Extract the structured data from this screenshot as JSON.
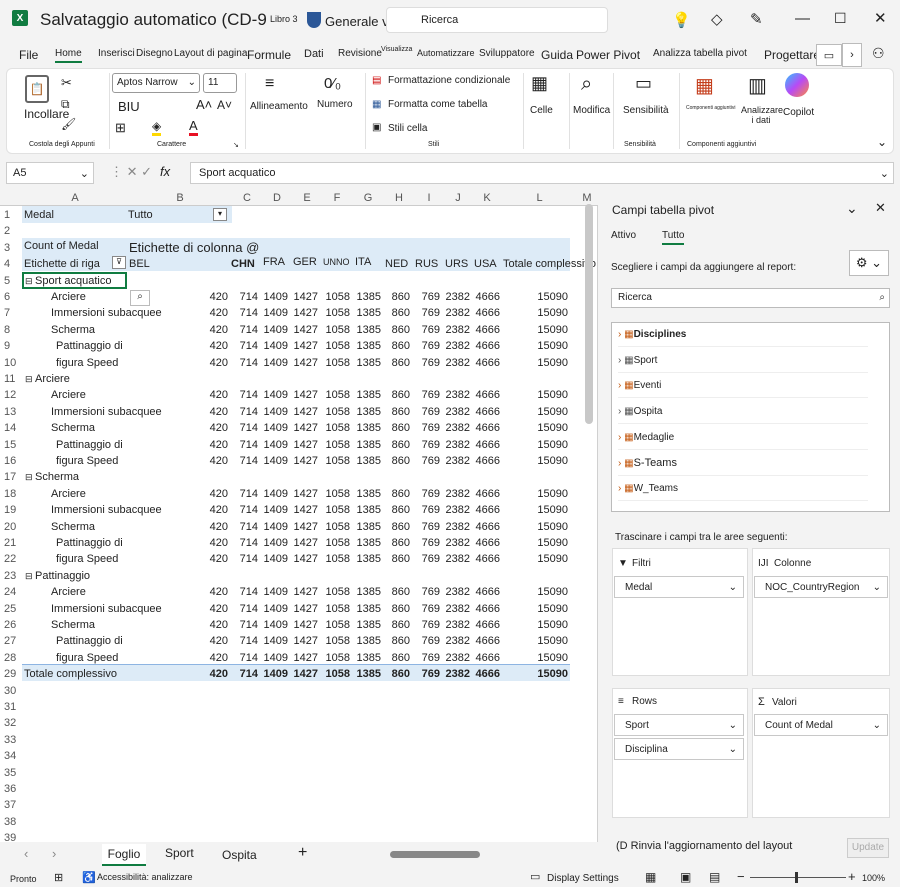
{
  "app": {
    "title": "Salvataggio automatico (CD-9",
    "file": "Libro 3",
    "label": "Generale v p",
    "search": "Ricerca"
  },
  "tabs": [
    "File",
    "Home",
    "Inserisci",
    "Disegno",
    "Layout di pagina",
    "Formule",
    "Dati",
    "Revisione",
    "Visualizza",
    "Automatizzare",
    "Sviluppatore",
    "Guida",
    "Power Pivot",
    "Analizza tabella pivot",
    "Progettare"
  ],
  "ribbon": {
    "paste": "Incollare",
    "clipboard": "Costola degli Appunti",
    "font_name": "Aptos Narrow",
    "font_size": "11",
    "biu": "BIU",
    "font_group": "Carattere",
    "align": "Allineamento",
    "number": "Numero",
    "cond": "Formattazione condizionale",
    "table": "Formatta come tabella",
    "styles": "Stili cella",
    "styles_group": "Stili",
    "cells": "Celle",
    "modify": "Modifica",
    "sens": "Sensibilità",
    "sens_group": "Sensibilità",
    "addins": "Componenti aggiuntivi",
    "analyze": "Analizzare i dati",
    "addins_group": "Componenti aggiuntivi",
    "copilot": "Copilot"
  },
  "formula": {
    "ref": "A5",
    "fx": "fx",
    "value": "Sport acquatico"
  },
  "columns": [
    "A",
    "B",
    "C",
    "D",
    "E",
    "F",
    "G",
    "H",
    "I",
    "J",
    "K",
    "L",
    "M"
  ],
  "pivot": {
    "filter_label": "Medal",
    "filter_value": "Tutto",
    "count_label": "Count of Medal",
    "col_labels": "Etichette di colonna @",
    "row_labels": "Etichette di riga",
    "countries": [
      "BEL",
      "CHN",
      "FRA",
      "GER",
      "UNNO",
      "ITA",
      "NED",
      "RUS",
      "URS",
      "USA",
      "Totale complessivo"
    ],
    "values": [
      "420",
      "714",
      "1409",
      "1427",
      "1058",
      "1385",
      "860",
      "769",
      "2382",
      "4666",
      "15090"
    ],
    "groups": [
      {
        "name": "Sport acquatico",
        "items": [
          "Arciere",
          "Immersioni subacquee",
          "Scherma",
          "Pattinaggio di",
          "figura Speed"
        ]
      },
      {
        "name": "Arciere",
        "items": [
          "Arciere",
          "Immersioni subacquee",
          "Scherma",
          "Pattinaggio di",
          "figura Speed"
        ]
      },
      {
        "name": "Scherma",
        "items": [
          "Arciere",
          "Immersioni subacquee",
          "Scherma",
          "Pattinaggio di",
          "figura Speed"
        ]
      },
      {
        "name": "Pattinaggio",
        "items": [
          "Arciere",
          "Immersioni subacquee",
          "Scherma",
          "Pattinaggio di",
          "figura Speed"
        ]
      }
    ],
    "grand_total": "Totale complessivo"
  },
  "pane": {
    "title": "Campi tabella pivot",
    "tab_active": "Attivo",
    "tab_all": "Tutto",
    "choose": "Scegliere i campi da aggiungere al report:",
    "search": "Ricerca",
    "fields": [
      "Disciplines",
      "Sport",
      "Eventi",
      "Ospita",
      "Medaglie",
      "S-Teams",
      "W_Teams"
    ],
    "drag": "Trascinare i campi tra le aree seguenti:",
    "filters": "Filtri",
    "columns": "Colonne",
    "rows": "Rows",
    "values": "Valori",
    "filter_item": "Medal",
    "column_item": "NOC_CountryRegion",
    "row_items": [
      "Sport",
      "Disciplina"
    ],
    "value_item": "Count of Medal",
    "defer": "(D Rinvia l'aggiornamento del layout",
    "update": "Update"
  },
  "sheets": [
    "Foglio",
    "Sport",
    "Ospita"
  ],
  "status": {
    "ready": "Pronto",
    "access": "Accessibilità: analizzare",
    "display": "Display Settings",
    "zoom": "100%"
  }
}
